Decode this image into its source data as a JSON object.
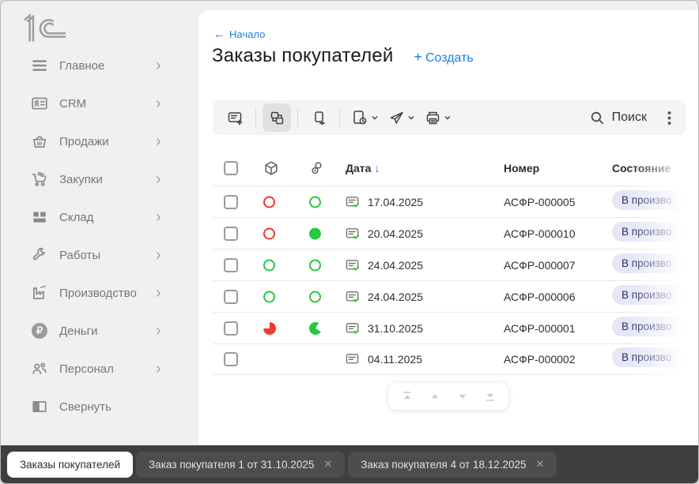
{
  "app": {
    "logo_text": "1С"
  },
  "icons": {
    "back_arrow": "←",
    "plus": "+",
    "sort_desc": "↓",
    "chevron_right": "›",
    "close": "✕",
    "ruble": "₽"
  },
  "sidebar": {
    "items": [
      {
        "label": "Главное"
      },
      {
        "label": "CRM"
      },
      {
        "label": "Продажи"
      },
      {
        "label": "Закупки"
      },
      {
        "label": "Склад"
      },
      {
        "label": "Работы"
      },
      {
        "label": "Производство"
      },
      {
        "label": "Деньги"
      },
      {
        "label": "Персонал"
      }
    ],
    "collapse_label": "Свернуть"
  },
  "header": {
    "breadcrumb": "Начало",
    "title": "Заказы покупателей",
    "create_label": "Создать"
  },
  "toolbar": {
    "search_label": "Поиск"
  },
  "table": {
    "columns": {
      "date": "Дата",
      "number": "Номер",
      "state": "Состояние"
    },
    "rows": [
      {
        "date": "17.04.2025",
        "number": "АСФР-000005",
        "state": "В произво",
        "shipment": "red-outline",
        "payment": "green-outline",
        "doc": "checked"
      },
      {
        "date": "20.04.2025",
        "number": "АСФР-000010",
        "state": "В произво",
        "shipment": "red-outline",
        "payment": "green-filled",
        "doc": "checked"
      },
      {
        "date": "24.04.2025",
        "number": "АСФР-000007",
        "state": "В произво",
        "shipment": "green-outline",
        "payment": "green-outline",
        "doc": "checked"
      },
      {
        "date": "24.04.2025",
        "number": "АСФР-000006",
        "state": "В произво",
        "shipment": "green-outline",
        "payment": "green-outline",
        "doc": "checked"
      },
      {
        "date": "31.10.2025",
        "number": "АСФР-000001",
        "state": "В произво",
        "shipment": "red-pie",
        "payment": "green-pie",
        "doc": "checked"
      },
      {
        "date": "04.11.2025",
        "number": "АСФР-000002",
        "state": "В произво",
        "shipment": "none",
        "payment": "none",
        "doc": "plain"
      }
    ]
  },
  "tabbar": {
    "tabs": [
      {
        "label": "Заказы покупателей"
      },
      {
        "label": "Заказ покупателя 1 от 31.10.2025"
      },
      {
        "label": "Заказ покупателя 4 от 18.12.2025"
      }
    ]
  },
  "colors": {
    "accent_blue": "#1b7fe4",
    "green": "#27c93f",
    "red": "#f4372c",
    "badge_bg": "#e6e6f7",
    "badge_text": "#2b2b63",
    "tabbar_bg": "#3e3e3e"
  }
}
